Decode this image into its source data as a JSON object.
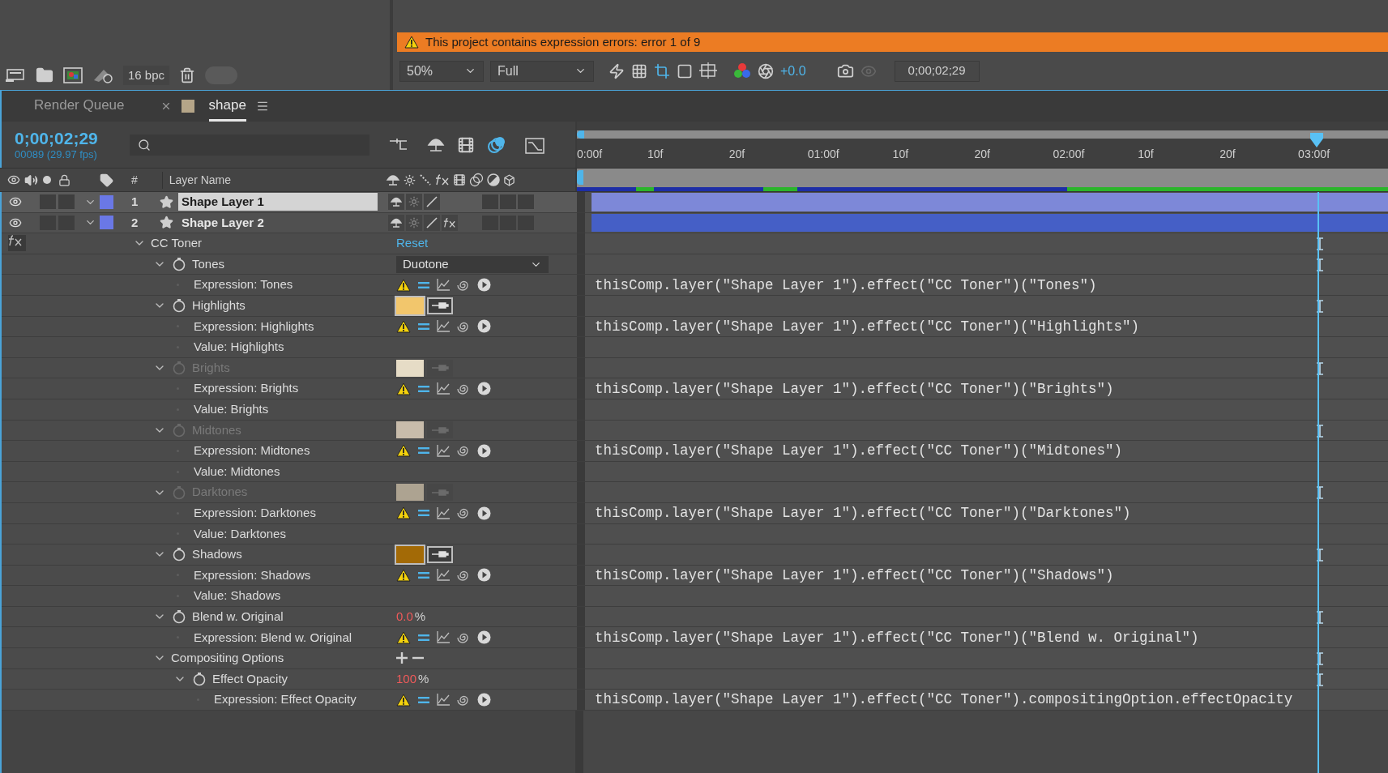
{
  "project_panel": {
    "bit_depth": "16 bpc"
  },
  "viewer": {
    "warning": "This project contains expression errors: error 1 of 9",
    "zoom": "50%",
    "resolution": "Full",
    "exposure": "+0.0",
    "timecode": "0;00;02;29"
  },
  "timeline": {
    "tabs": [
      {
        "label": "Render Queue",
        "selected": false,
        "closable": false
      },
      {
        "label": "shape",
        "selected": true,
        "closable": true,
        "color": "#b5a588"
      }
    ],
    "current_time": "0;00;02;29",
    "frame_info": "00089 (29.97 fps)",
    "columns": {
      "number": "#",
      "name": "Layer Name"
    },
    "ruler": [
      "0:00f",
      "10f",
      "20f",
      "01:00f",
      "10f",
      "20f",
      "02:00f",
      "10f",
      "20f",
      "03:00f"
    ],
    "layers": [
      {
        "number": "1",
        "name": "Shape Layer 1",
        "selected": true,
        "color": "#6a78e6",
        "fx": false,
        "audio": false,
        "solo": false,
        "frame_blend": false,
        "motion_blur": false,
        "adjustment": false
      },
      {
        "number": "2",
        "name": "Shape Layer 2",
        "selected": false,
        "color": "#6a78e6",
        "fx": true,
        "audio": false,
        "solo": false,
        "frame_blend": false,
        "motion_blur": false,
        "adjustment": false
      }
    ],
    "effects": [
      {
        "kind": "effect",
        "label": "CC Toner",
        "expanded": true,
        "reset": "Reset",
        "children": [
          {
            "kind": "property",
            "label": "Tones",
            "expanded": true,
            "dimmed": false,
            "control": {
              "kind": "dropdown",
              "value": "Duotone"
            },
            "children": [
              {
                "kind": "expression",
                "label": "Expression: Tones",
                "code": "thisComp.layer(\"Shape Layer 1\").effect(\"CC Toner\")(\"Tones\")"
              }
            ]
          },
          {
            "kind": "property",
            "label": "Highlights",
            "expanded": true,
            "dimmed": false,
            "control": {
              "kind": "color",
              "color": "#f2c66c"
            },
            "children": [
              {
                "kind": "expression",
                "label": "Expression: Highlights",
                "code": "thisComp.layer(\"Shape Layer 1\").effect(\"CC Toner\")(\"Highlights\")"
              },
              {
                "kind": "value",
                "label": "Value: Highlights"
              }
            ]
          },
          {
            "kind": "property",
            "label": "Brights",
            "expanded": true,
            "dimmed": true,
            "control": {
              "kind": "color",
              "color": "#e6dcc6"
            },
            "children": [
              {
                "kind": "expression",
                "label": "Expression: Brights",
                "code": "thisComp.layer(\"Shape Layer 1\").effect(\"CC Toner\")(\"Brights\")"
              },
              {
                "kind": "value",
                "label": "Value: Brights"
              }
            ]
          },
          {
            "kind": "property",
            "label": "Midtones",
            "expanded": true,
            "dimmed": true,
            "control": {
              "kind": "color",
              "color": "#c8bcab"
            },
            "children": [
              {
                "kind": "expression",
                "label": "Expression: Midtones",
                "code": "thisComp.layer(\"Shape Layer 1\").effect(\"CC Toner\")(\"Midtones\")"
              },
              {
                "kind": "value",
                "label": "Value: Midtones"
              }
            ]
          },
          {
            "kind": "property",
            "label": "Darktones",
            "expanded": true,
            "dimmed": true,
            "control": {
              "kind": "color",
              "color": "#ada391"
            },
            "children": [
              {
                "kind": "expression",
                "label": "Expression: Darktones",
                "code": "thisComp.layer(\"Shape Layer 1\").effect(\"CC Toner\")(\"Darktones\")"
              },
              {
                "kind": "value",
                "label": "Value: Darktones"
              }
            ]
          },
          {
            "kind": "property",
            "label": "Shadows",
            "expanded": true,
            "dimmed": false,
            "control": {
              "kind": "color",
              "color": "#a36a06"
            },
            "children": [
              {
                "kind": "expression",
                "label": "Expression: Shadows",
                "code": "thisComp.layer(\"Shape Layer 1\").effect(\"CC Toner\")(\"Shadows\")"
              },
              {
                "kind": "value",
                "label": "Value: Shadows"
              }
            ]
          },
          {
            "kind": "property",
            "label": "Blend w. Original",
            "expanded": true,
            "dimmed": false,
            "control": {
              "kind": "percent",
              "value": "0.0",
              "unit": "%"
            },
            "children": [
              {
                "kind": "expression",
                "label": "Expression: Blend w. Original",
                "code": "thisComp.layer(\"Shape Layer 1\").effect(\"CC Toner\")(\"Blend w. Original\")"
              }
            ]
          },
          {
            "kind": "group",
            "label": "Compositing Options",
            "expanded": true,
            "control": {
              "kind": "add-remove"
            },
            "children": [
              {
                "kind": "property",
                "label": "Effect Opacity",
                "expanded": true,
                "dimmed": false,
                "control": {
                  "kind": "percent",
                  "value": "100",
                  "unit": "%"
                },
                "children": [
                  {
                    "kind": "expression",
                    "label": "Expression: Effect Opacity",
                    "code": "thisComp.layer(\"Shape Layer 1\").effect(\"CC Toner\").compositingOption.effectOpacity"
                  }
                ]
              }
            ]
          }
        ]
      }
    ]
  }
}
